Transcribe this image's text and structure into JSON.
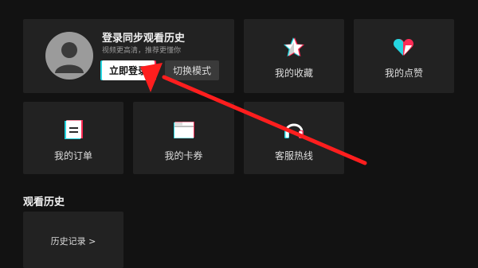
{
  "profile": {
    "title": "登录同步观看历史",
    "subtitle": "视频更高清，推荐更懂你",
    "login_button": "立即登录",
    "switch_mode_button": "切换模式"
  },
  "tiles": {
    "favorites": "我的收藏",
    "likes": "我的点赞",
    "orders": "我的订单",
    "coupons": "我的卡券",
    "service": "客服热线"
  },
  "history": {
    "heading": "观看历史",
    "link": "历史记录 >"
  },
  "colors": {
    "background": "#121212",
    "card": "#222222",
    "accent_cyan": "#25d5e0",
    "accent_red": "#ff2b55",
    "annotation_arrow": "#ff1e1e"
  },
  "icons": {
    "favorites": "star-icon",
    "likes": "heart-icon",
    "orders": "order-doc-icon",
    "coupons": "coupon-folder-icon",
    "service": "headset-icon"
  }
}
